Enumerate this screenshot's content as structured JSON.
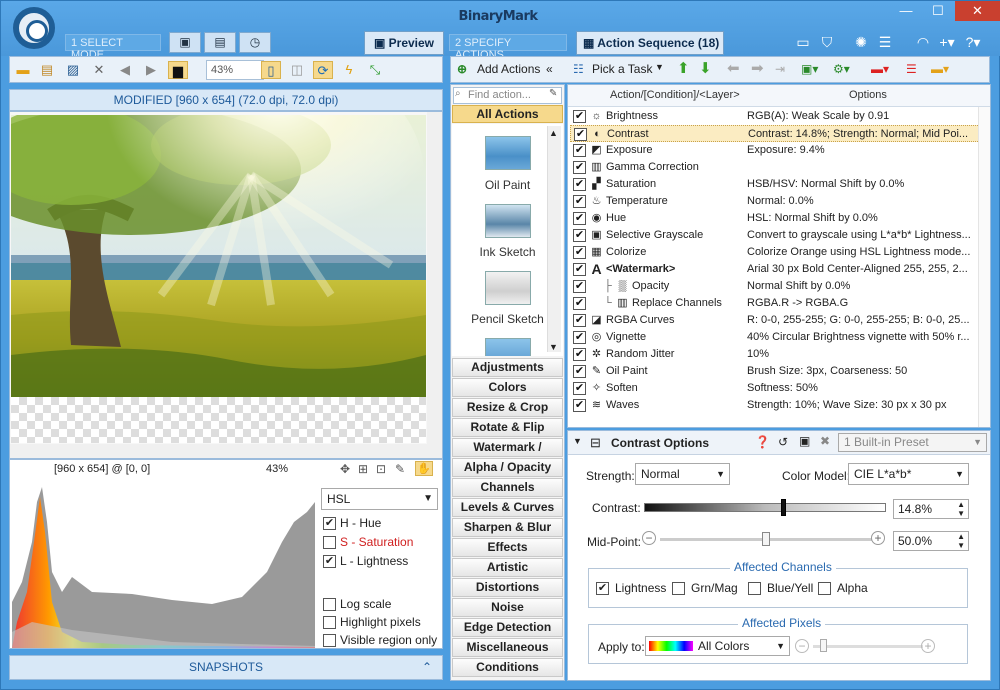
{
  "app": {
    "brand": "BinaryMark"
  },
  "steps": {
    "select_mode": "1 SELECT MODE",
    "specify_actions": "2 SPECIFY ACTIONS"
  },
  "tabs": {
    "preview": "Preview",
    "action_sequence": "Action Sequence (18)"
  },
  "window_buttons": {
    "minimize": "—",
    "maximize": "☐",
    "close": "✕"
  },
  "left_toolbar": {
    "zoom": "43%"
  },
  "image_header": "MODIFIED [960 x 654] (72.0 dpi, 72.0 dpi)",
  "image_status": {
    "size": "[960 x 654] @ [0, 0]",
    "zoom": "43%"
  },
  "histogram": {
    "mode": "HSL",
    "channels": [
      {
        "label": "H - Hue",
        "checked": true,
        "color": "#222222"
      },
      {
        "label": "S - Saturation",
        "checked": false,
        "color": "#d02020"
      },
      {
        "label": "L - Lightness",
        "checked": true,
        "color": "#222222"
      }
    ],
    "options": [
      {
        "label": "Log scale",
        "checked": false
      },
      {
        "label": "Highlight pixels",
        "checked": false
      },
      {
        "label": "Visible region only",
        "checked": false
      }
    ]
  },
  "snapshots": "SNAPSHOTS",
  "actions_panel": {
    "find_placeholder": "Find action...",
    "all_actions": "All Actions",
    "thumbs": [
      "Oil Paint",
      "Ink Sketch",
      "Pencil Sketch"
    ],
    "categories": [
      "Adjustments",
      "Colors",
      "Resize & Crop",
      "Rotate & Flip",
      "Watermark / Overlay",
      "Alpha / Opacity",
      "Channels",
      "Levels & Curves",
      "Sharpen & Blur",
      "Effects",
      "Artistic",
      "Distortions",
      "Noise",
      "Edge Detection",
      "Miscellaneous",
      "Conditions"
    ]
  },
  "right_toolbar": {
    "add_actions": "Add Actions",
    "pick_task": "Pick a Task"
  },
  "sequence": {
    "col_action": "Action/[Condition]/<Layer>",
    "col_options": "Options",
    "rows": [
      {
        "name": "Brightness",
        "icon": "☼",
        "opt": "RGB(A): Weak Scale by 0.91",
        "checked": true
      },
      {
        "name": "Contrast",
        "icon": "◐",
        "opt": "Contrast: 14.8%; Strength: Normal; Mid Poi...",
        "checked": true
      },
      {
        "name": "Exposure",
        "icon": "◩",
        "opt": "Exposure: 9.4%",
        "checked": true
      },
      {
        "name": "Gamma Correction",
        "icon": "▥",
        "opt": "",
        "checked": true
      },
      {
        "name": "Saturation",
        "icon": "▞",
        "opt": "HSB/HSV: Normal Shift by 0.0%",
        "checked": true
      },
      {
        "name": "Temperature",
        "icon": "♨",
        "opt": "Normal: 0.0%",
        "checked": true
      },
      {
        "name": "Hue",
        "icon": "◉",
        "opt": "HSL: Normal Shift by 0.0%",
        "checked": true
      },
      {
        "name": "Selective Grayscale",
        "icon": "▣",
        "opt": "Convert to grayscale using L*a*b* Lightness...",
        "checked": true
      },
      {
        "name": "Colorize",
        "icon": "▦",
        "opt": "Colorize Orange using HSL Lightness mode...",
        "checked": true
      },
      {
        "name": "<Watermark>",
        "icon": "A",
        "opt": "Arial 30 px Bold Center-Aligned 255, 255, 2...",
        "checked": true
      },
      {
        "name": "Opacity",
        "icon": "▒",
        "opt": "Normal Shift by 0.0%",
        "checked": true,
        "indent": true
      },
      {
        "name": "Replace Channels",
        "icon": "▥",
        "opt": "RGBA.R -> RGBA.G",
        "checked": true,
        "indent": true
      },
      {
        "name": "RGBA Curves",
        "icon": "◪",
        "opt": "R: 0-0, 255-255; G: 0-0, 255-255; B: 0-0, 25...",
        "checked": true
      },
      {
        "name": "Vignette",
        "icon": "◎",
        "opt": "40% Circular Brightness vignette with 50% r...",
        "checked": true
      },
      {
        "name": "Random Jitter",
        "icon": "✲",
        "opt": "10%",
        "checked": true
      },
      {
        "name": "Oil Paint",
        "icon": "✎",
        "opt": "Brush Size: 3px, Coarseness: 50",
        "checked": true
      },
      {
        "name": "Soften",
        "icon": "✧",
        "opt": "Softness: 50%",
        "checked": true
      },
      {
        "name": "Waves",
        "icon": "≋",
        "opt": "Strength: 10%; Wave Size: 30 px x 30 px",
        "checked": true
      }
    ]
  },
  "contrast_options": {
    "title": "Contrast Options",
    "preset": "1 Built-in Preset",
    "strength_label": "Strength:",
    "strength_value": "Normal",
    "color_model_label": "Color Model:",
    "color_model_value": "CIE L*a*b*",
    "contrast_label": "Contrast:",
    "contrast_value": "14.8%",
    "contrast_level": 0.574,
    "midpoint_label": "Mid-Point:",
    "midpoint_value": "50.0%",
    "midpoint_level": 0.5,
    "affected_channels_title": "Affected Channels",
    "channels": [
      {
        "label": "Lightness",
        "checked": true
      },
      {
        "label": "Grn/Mag",
        "checked": false
      },
      {
        "label": "Blue/Yell",
        "checked": false
      },
      {
        "label": "Alpha",
        "checked": false
      }
    ],
    "affected_pixels_title": "Affected Pixels",
    "apply_to_label": "Apply to:",
    "apply_to_value": "All Colors"
  }
}
